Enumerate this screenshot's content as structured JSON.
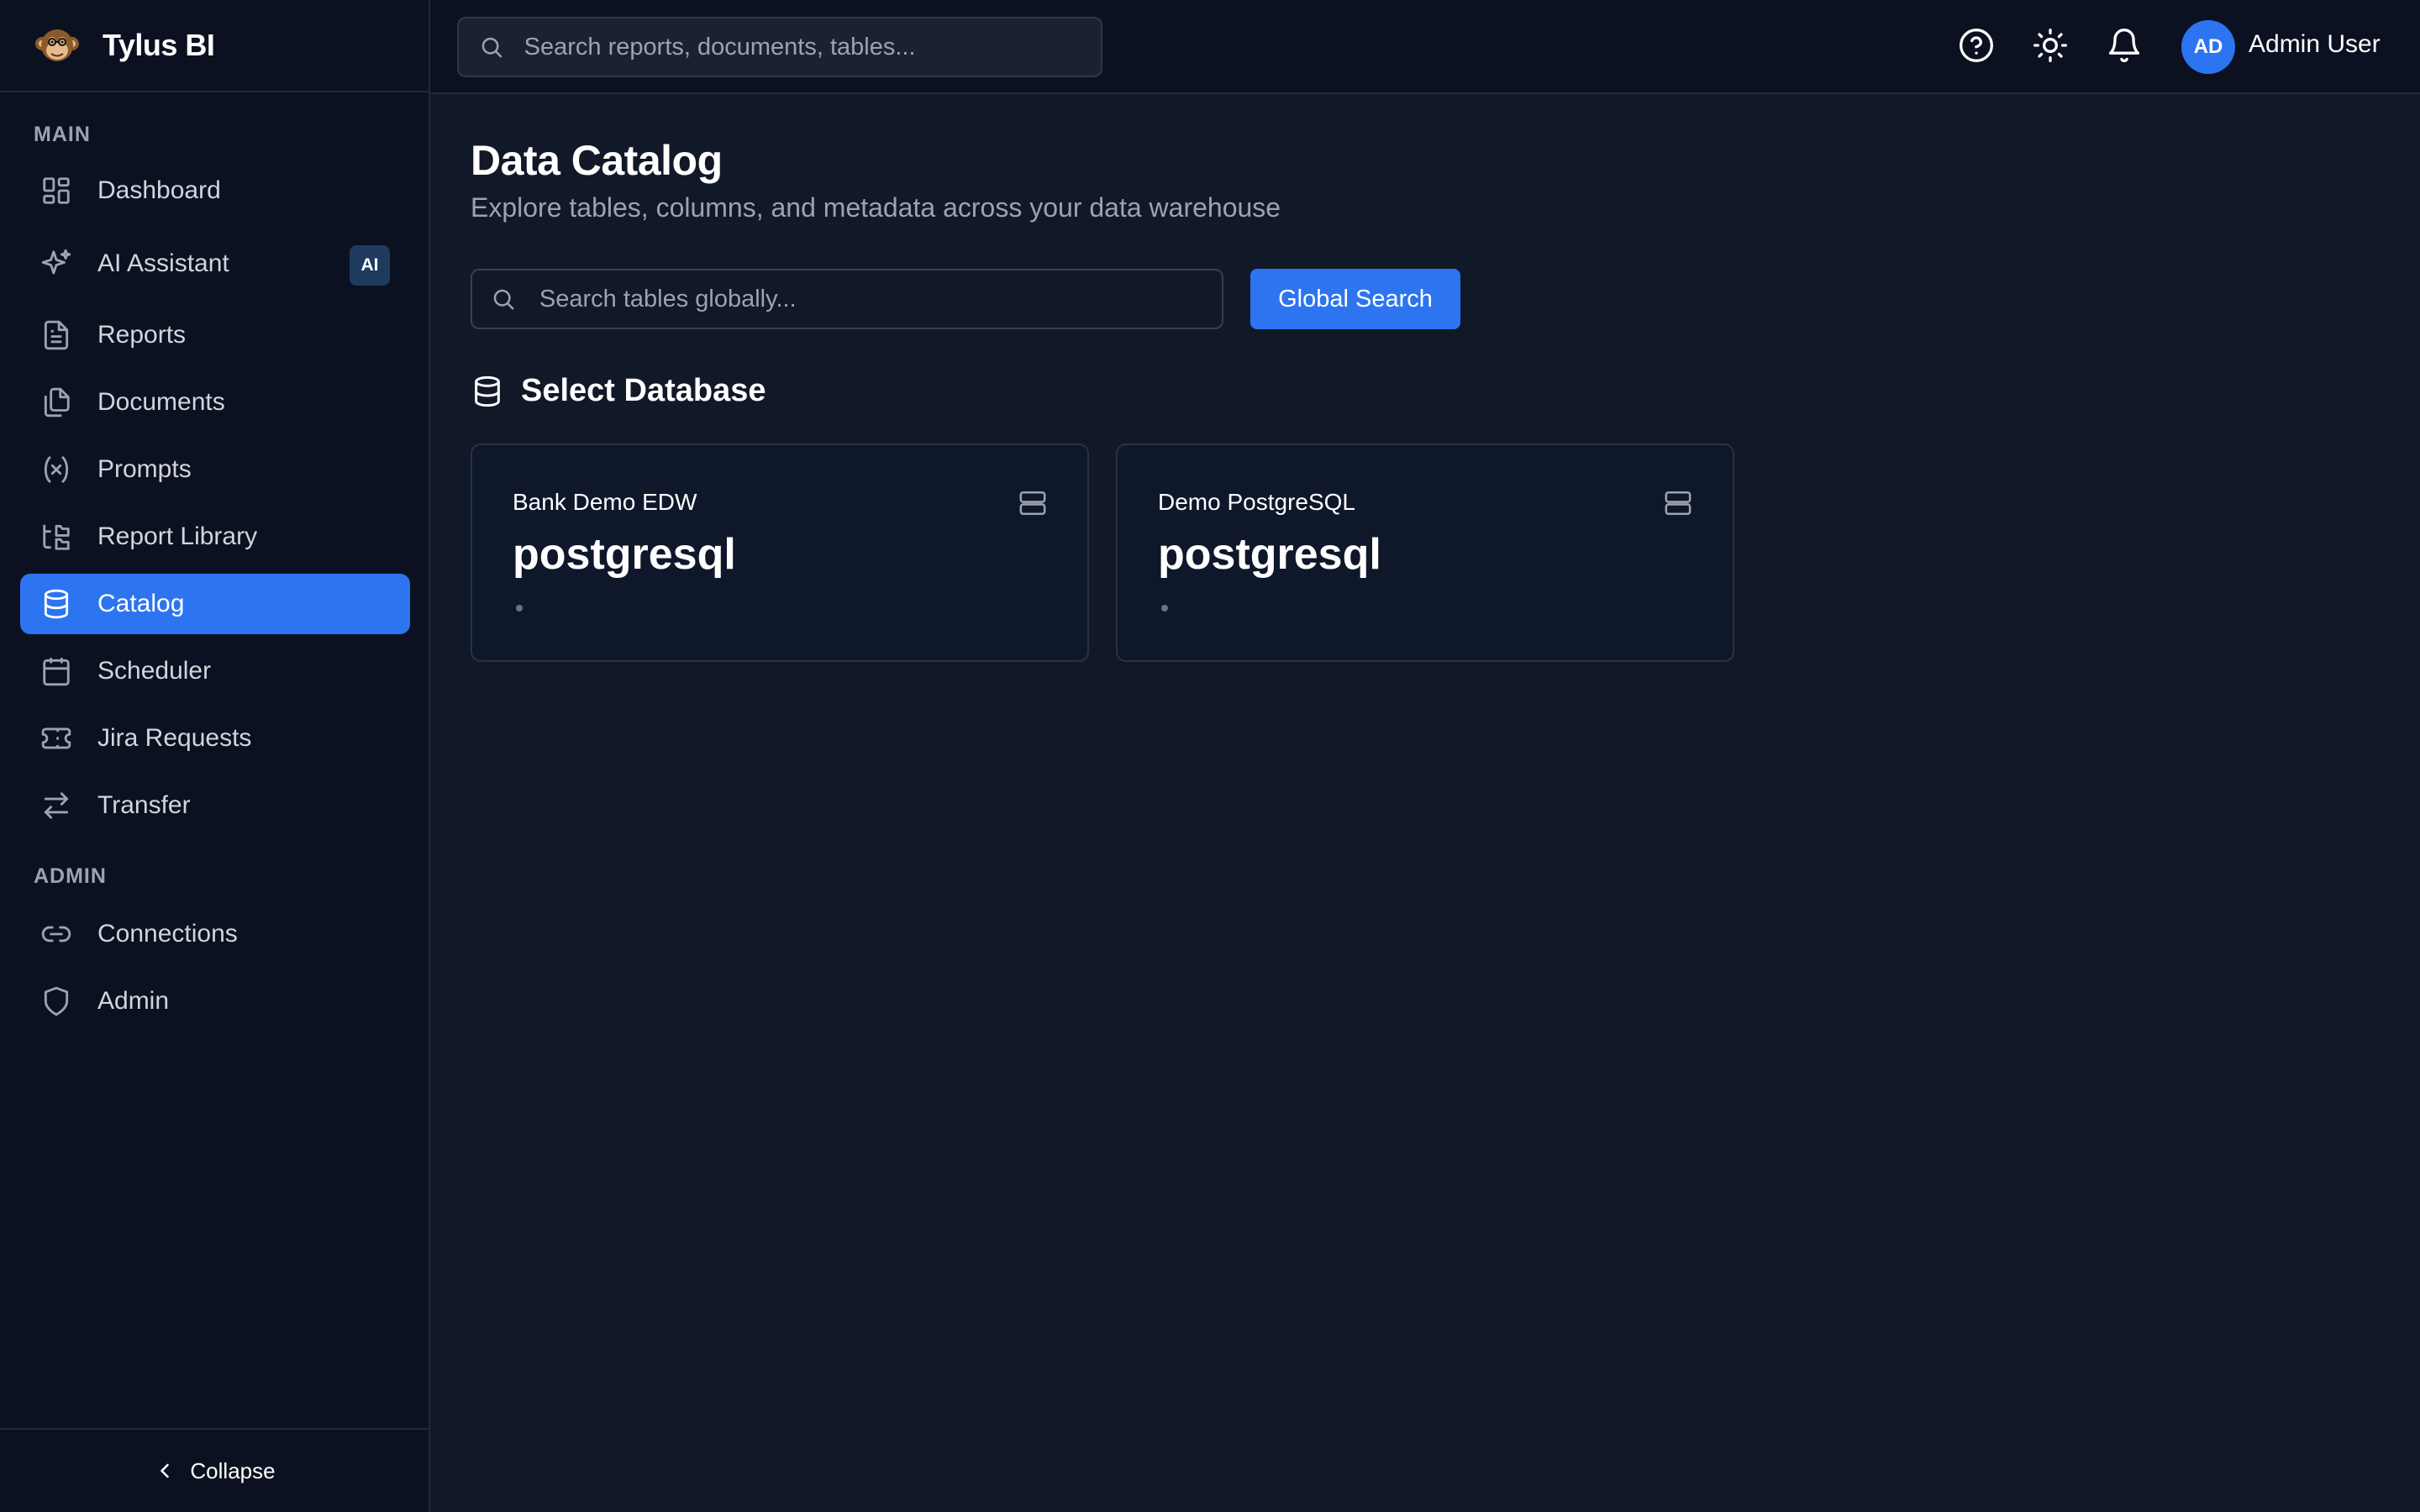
{
  "app": {
    "name": "Tylus BI"
  },
  "header": {
    "search_placeholder": "Search reports, documents, tables...",
    "user": {
      "initials": "AD",
      "name": "Admin User"
    }
  },
  "sidebar": {
    "main_title": "MAIN",
    "admin_title": "ADMIN",
    "items": [
      {
        "label": "Dashboard",
        "icon": "dashboard-icon"
      },
      {
        "label": "AI Assistant",
        "icon": "sparkle-icon",
        "badge": "AI"
      },
      {
        "label": "Reports",
        "icon": "file-text-icon"
      },
      {
        "label": "Documents",
        "icon": "files-icon"
      },
      {
        "label": "Prompts",
        "icon": "variable-icon"
      },
      {
        "label": "Report Library",
        "icon": "folder-tree-icon"
      },
      {
        "label": "Catalog",
        "icon": "database-icon",
        "active": true
      },
      {
        "label": "Scheduler",
        "icon": "calendar-icon"
      },
      {
        "label": "Jira Requests",
        "icon": "ticket-icon"
      },
      {
        "label": "Transfer",
        "icon": "arrows-exchange-icon"
      }
    ],
    "admin_items": [
      {
        "label": "Connections",
        "icon": "link-icon"
      },
      {
        "label": "Admin",
        "icon": "shield-icon"
      }
    ],
    "collapse_label": "Collapse"
  },
  "main": {
    "title": "Data Catalog",
    "subtitle": "Explore tables, columns, and metadata across your data warehouse",
    "search_placeholder": "Search tables globally...",
    "global_search_label": "Global Search",
    "section_title": "Select Database",
    "databases": [
      {
        "name": "Bank Demo EDW",
        "type": "postgresql"
      },
      {
        "name": "Demo PostgreSQL",
        "type": "postgresql"
      }
    ]
  },
  "colors": {
    "accent": "#2d74f0",
    "background": "#111827",
    "sidebar": "#0b1120"
  }
}
